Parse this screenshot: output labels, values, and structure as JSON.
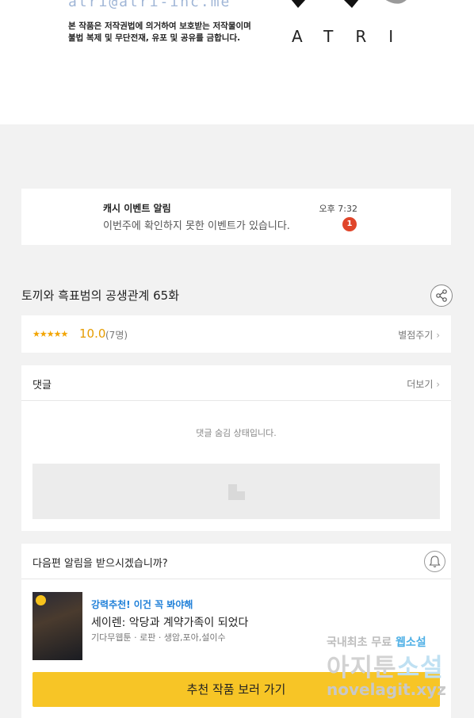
{
  "header": {
    "email": "atri@atri-inc.me",
    "copyright_line1": "본 작품은 저작권법에 의거하여 보호받는 저작물이며",
    "copyright_line2": "불법 복제 및 무단전재, 유포 및 공유를 금합니다.",
    "logo_text": "ATRI"
  },
  "notification": {
    "title": "캐시 이벤트 알림",
    "message": "이번주에 확인하지 못한 이벤트가 있습니다.",
    "time": "오후 7:32",
    "badge": "1",
    "badge_color": "#e0452a"
  },
  "episode": {
    "title": "토끼와 흑표범의 공생관계 65화",
    "share_icon": "share-icon"
  },
  "rating": {
    "stars": "★★★★★",
    "score": "10.0",
    "count": "(7명)",
    "rate_link": "별점주기",
    "star_color": "#f2a400"
  },
  "comments": {
    "title": "댓글",
    "more": "더보기",
    "hidden_text": "댓글 숨김 상태입니다."
  },
  "next_episode": {
    "question": "다음편 알림을 받으시겠습니까?",
    "bell_icon": "bell-icon",
    "rec_tag": "강력추천! 이건 꼭 봐야해",
    "rec_title": "세이렌: 악당과 계약가족이 되었다",
    "rec_genre": "기다무웹툰 · 로판 · 생암,포아,설이수",
    "button_label": "추천 작품 보러 가기",
    "button_color": "#f7c526",
    "accent_color": "#1e7fd8"
  },
  "watermark": {
    "line1_a": "국내최초 무료 ",
    "line1_b": "웹소설",
    "line2_a": "아지툰",
    "line2_b": "소설",
    "line3": "novelagit.xyz"
  }
}
